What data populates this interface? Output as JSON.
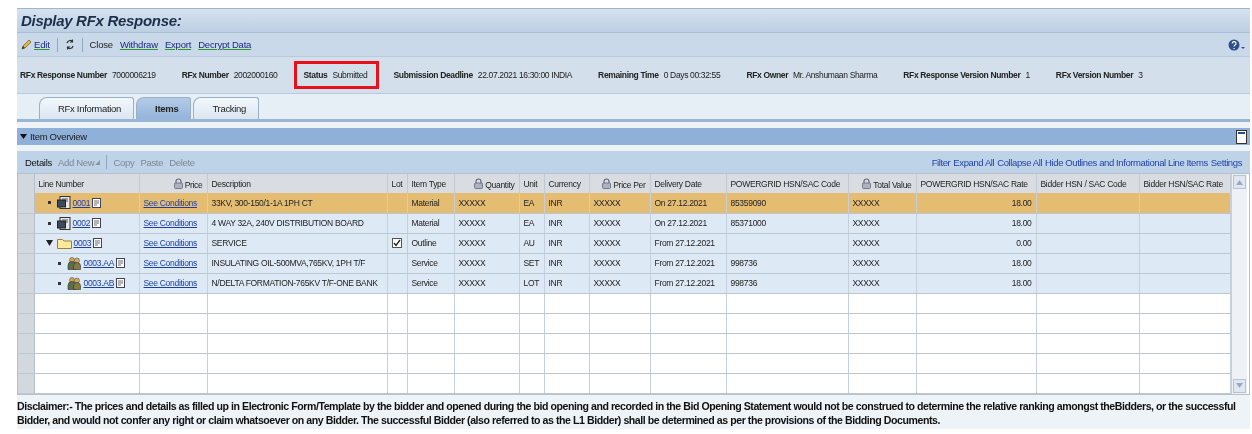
{
  "title": "Display RFx Response:",
  "toolbar": [
    {
      "kind": "edit",
      "label": "Edit"
    },
    {
      "kind": "refresh"
    },
    {
      "kind": "text",
      "label": "Close"
    },
    {
      "kind": "link",
      "label": "Withdraw"
    },
    {
      "kind": "link",
      "label": "Export"
    },
    {
      "kind": "link",
      "label": "Decrypt Data"
    }
  ],
  "info": [
    {
      "label": "RFx Response Number",
      "value": "7000006219",
      "highlighted": false
    },
    {
      "label": "RFx Number",
      "value": "2002000160",
      "highlighted": false
    },
    {
      "label": "Status",
      "value": "Submitted",
      "highlighted": true
    },
    {
      "label": "Submission Deadline",
      "value": "22.07.2021 16:30:00 INDIA",
      "highlighted": false
    },
    {
      "label": "Remaining Time",
      "value": "0 Days 00:32:55",
      "highlighted": false
    },
    {
      "label": "RFx Owner",
      "value": "Mr. Anshumaan Sharma",
      "highlighted": false
    },
    {
      "label": "RFx Response Version Number",
      "value": "1",
      "highlighted": false
    },
    {
      "label": "RFx Version Number",
      "value": "3",
      "highlighted": false
    }
  ],
  "tabs": [
    {
      "label": "RFx Information",
      "selected": false
    },
    {
      "label": "Items",
      "selected": true
    },
    {
      "label": "Tracking",
      "selected": false
    }
  ],
  "section": {
    "title": "Item Overview",
    "expanded": true
  },
  "table_actions": [
    {
      "label": "Details",
      "disabled": false
    },
    {
      "label": "Add New",
      "disabled": true,
      "menu": true
    },
    {
      "label": "Copy",
      "disabled": true
    },
    {
      "label": "Paste",
      "disabled": true
    },
    {
      "label": "Delete",
      "disabled": true
    }
  ],
  "table_links": [
    "Filter",
    "Expand All",
    "Collapse All",
    "Hide Outlines and Informational Line Items",
    "Settings"
  ],
  "columns": [
    {
      "label": "Line Number",
      "locked": false
    },
    {
      "label": "Price",
      "locked": true
    },
    {
      "label": "Description",
      "locked": false
    },
    {
      "label": "Lot",
      "locked": false
    },
    {
      "label": "Item Type",
      "locked": false
    },
    {
      "label": "Quantity",
      "locked": true
    },
    {
      "label": "Unit",
      "locked": false
    },
    {
      "label": "Currency",
      "locked": false
    },
    {
      "label": "Price Per",
      "locked": true
    },
    {
      "label": "Delivery Date",
      "locked": false
    },
    {
      "label": "POWERGRID HSN/SAC Code",
      "locked": false
    },
    {
      "label": "Total Value",
      "locked": true
    },
    {
      "label": "POWERGRID HSN/SAC Rate",
      "locked": false
    },
    {
      "label": "Bidder HSN / SAC Code",
      "locked": false
    },
    {
      "label": "Bidder HSN/SAC Rate",
      "locked": false
    }
  ],
  "rows": [
    {
      "line": "0001",
      "kind": "material",
      "selected": true,
      "price": "See Conditions",
      "description": "33KV, 300-150/1-1A 1PH CT",
      "item_type": "Material",
      "quantity": "XXXXX",
      "unit": "EA",
      "currency": "INR",
      "price_per": "XXXXX",
      "delivery_date": "On 27.12.2021",
      "hsn_code": "85359090",
      "total_value": "XXXXX",
      "hsn_rate": "18.00"
    },
    {
      "line": "0002",
      "kind": "material",
      "selected": false,
      "price": "See Conditions",
      "description": "4 WAY 32A, 240V DISTRIBUTION BOARD",
      "item_type": "Material",
      "quantity": "XXXXX",
      "unit": "EA",
      "currency": "INR",
      "price_per": "XXXXX",
      "delivery_date": "On 27.12.2021",
      "hsn_code": "85371000",
      "total_value": "XXXXX",
      "hsn_rate": "18.00"
    },
    {
      "line": "0003",
      "kind": "outline",
      "selected": false,
      "expanded": true,
      "lot": true,
      "price": "See Conditions",
      "description": "SERVICE",
      "item_type": "Outline",
      "quantity": "XXXXX",
      "unit": "AU",
      "currency": "INR",
      "price_per": "XXXXX",
      "delivery_date": "From 27.12.2021",
      "total_value": "XXXXX",
      "hsn_rate": "0.00",
      "children": [
        {
          "line": "0003.AA",
          "kind": "service",
          "selected": false,
          "price": "See Conditions",
          "description": "INSULATING OIL-500MVA,765KV, 1PH T/F",
          "item_type": "Service",
          "quantity": "XXXXX",
          "unit": "SET",
          "currency": "INR",
          "price_per": "XXXXX",
          "delivery_date": "From 27.12.2021",
          "hsn_code": "998736",
          "total_value": "XXXXX",
          "hsn_rate": "18.00"
        },
        {
          "line": "0003.AB",
          "kind": "service",
          "selected": false,
          "price": "See Conditions",
          "description": "N/DELTA FORMATION-765KV T/F-ONE BANK",
          "item_type": "Service",
          "quantity": "XXXXX",
          "unit": "LOT",
          "currency": "INR",
          "price_per": "XXXXX",
          "delivery_date": "From 27.12.2021",
          "hsn_code": "998736",
          "total_value": "XXXXX",
          "hsn_rate": "18.00"
        }
      ]
    }
  ],
  "disclaimer": "Disclaimer:- The prices and details as filled up in Electronic Form/Template by the bidder and opened during the bid opening and recorded in the Bid Opening Statement would not be construed to determine the relative ranking amongst theBidders, or the successful Bidder, and would not confer any right or claim whatsoever on any Bidder. The successful Bidder (also referred to as the L1 Bidder) shall be determined as per the provisions of the Bidding Documents."
}
